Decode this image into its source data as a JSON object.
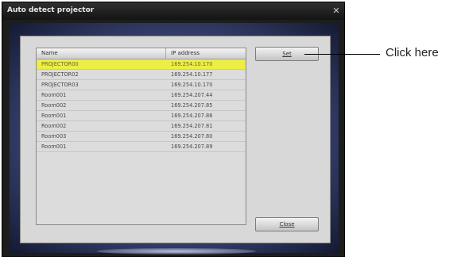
{
  "window": {
    "title": "Auto detect projector"
  },
  "list": {
    "headers": {
      "name": "Name",
      "ip": "IP address"
    },
    "rows": [
      {
        "name": "PROJECTOR00",
        "ip": "169.254.10.170",
        "selected": true
      },
      {
        "name": "PROJECTOR02",
        "ip": "169.254.10.177",
        "selected": false
      },
      {
        "name": "PROJECTOR03",
        "ip": "169.254.10.170",
        "selected": false
      },
      {
        "name": "Room001",
        "ip": "169.254.207.44",
        "selected": false
      },
      {
        "name": "Room002",
        "ip": "169.254.207.85",
        "selected": false
      },
      {
        "name": "Room001",
        "ip": "169.254.207.86",
        "selected": false
      },
      {
        "name": "Room002",
        "ip": "169.254.207.81",
        "selected": false
      },
      {
        "name": "Room003",
        "ip": "169.254.207.80",
        "selected": false
      },
      {
        "name": "Room001",
        "ip": "169.254.207.89",
        "selected": false
      }
    ]
  },
  "buttons": {
    "set": "Set",
    "close": "Close"
  },
  "callout": {
    "text": "Click here"
  },
  "colors": {
    "selected_row": "#ecee46",
    "window_frame": "#1d1d1d",
    "client_bg": "#3a4676"
  }
}
